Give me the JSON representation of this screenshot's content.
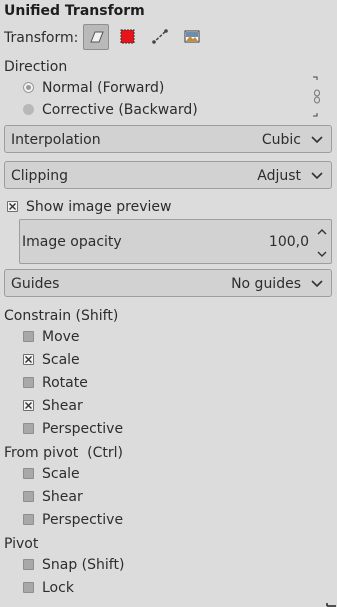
{
  "panel": {
    "title": "Unified Transform"
  },
  "transform": {
    "label": "Transform:",
    "buttons": [
      {
        "icon": "layer-transform-icon",
        "active": true
      },
      {
        "icon": "selection-transform-icon",
        "active": false
      },
      {
        "icon": "path-transform-icon",
        "active": false
      },
      {
        "icon": "image-transform-icon",
        "active": false
      }
    ]
  },
  "direction": {
    "label": "Direction",
    "options": [
      {
        "label": "Normal (Forward)",
        "selected": true
      },
      {
        "label": "Corrective (Backward)",
        "selected": false
      }
    ]
  },
  "interpolation": {
    "label": "Interpolation",
    "value": "Cubic"
  },
  "clipping": {
    "label": "Clipping",
    "value": "Adjust"
  },
  "preview": {
    "label": "Show image preview",
    "checked": true
  },
  "opacity": {
    "label": "Image opacity",
    "value": "100,0"
  },
  "guides": {
    "label": "Guides",
    "value": "No guides"
  },
  "constrain": {
    "label": "Constrain (Shift)",
    "items": [
      {
        "label": "Move",
        "checked": false
      },
      {
        "label": "Scale",
        "checked": true
      },
      {
        "label": "Rotate",
        "checked": false
      },
      {
        "label": "Shear",
        "checked": true
      },
      {
        "label": "Perspective",
        "checked": false
      }
    ]
  },
  "from_pivot": {
    "label": "From pivot  (Ctrl)",
    "items": [
      {
        "label": "Scale",
        "checked": false
      },
      {
        "label": "Shear",
        "checked": false
      },
      {
        "label": "Perspective",
        "checked": false
      }
    ]
  },
  "pivot": {
    "label": "Pivot",
    "items": [
      {
        "label": "Snap (Shift)",
        "checked": false
      },
      {
        "label": "Lock",
        "checked": false
      }
    ]
  },
  "colors": {
    "accent_red": "#e8141a",
    "panel_bg": "#dcdcdc"
  }
}
